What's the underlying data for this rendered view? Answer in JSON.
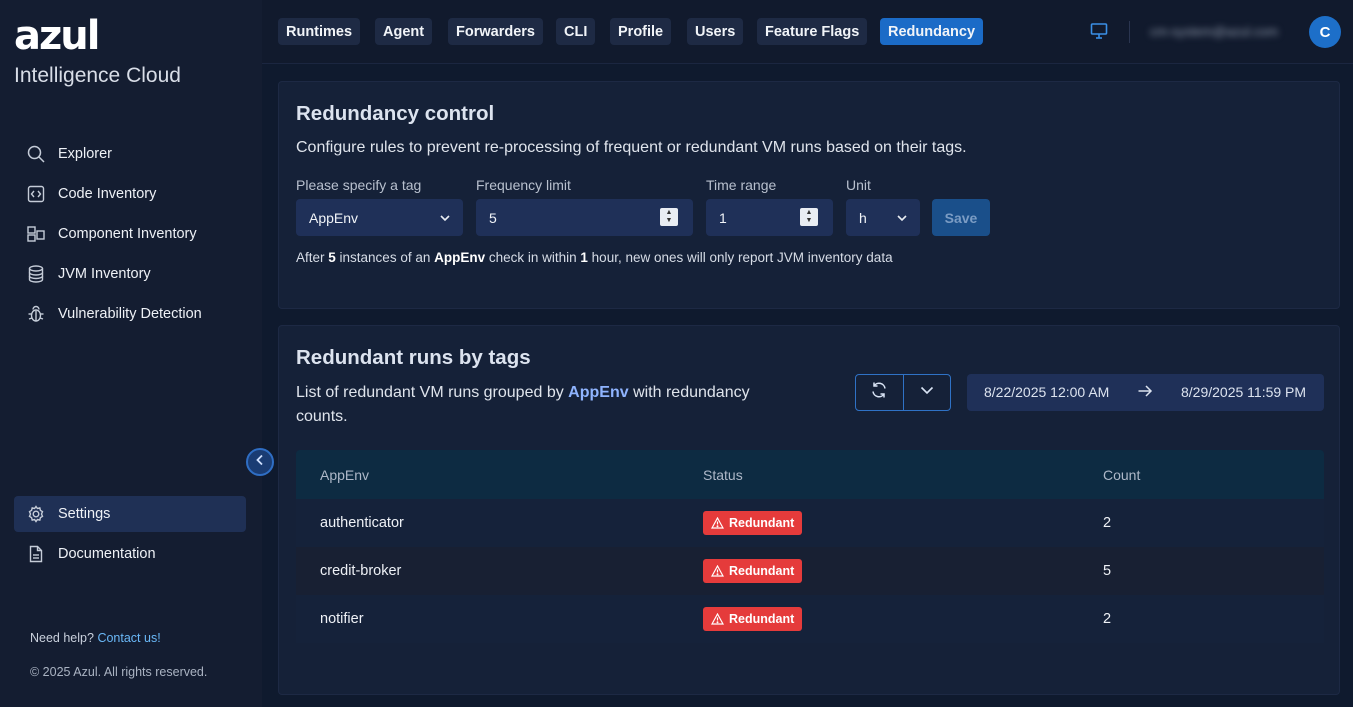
{
  "brand": {
    "logo": "azul",
    "subtitle": "Intelligence Cloud"
  },
  "sidebar": {
    "items": [
      {
        "label": "Explorer",
        "icon": "search-icon"
      },
      {
        "label": "Code Inventory",
        "icon": "code-icon"
      },
      {
        "label": "Component Inventory",
        "icon": "components-icon"
      },
      {
        "label": "JVM Inventory",
        "icon": "database-icon"
      },
      {
        "label": "Vulnerability Detection",
        "icon": "bug-icon"
      }
    ],
    "bottom_items": [
      {
        "label": "Settings",
        "icon": "gear-icon",
        "active": true
      },
      {
        "label": "Documentation",
        "icon": "document-icon"
      }
    ],
    "help_text": "Need help?",
    "help_link": "Contact us!",
    "copyright": "© 2025 Azul. All rights reserved."
  },
  "topbar": {
    "tabs": [
      "Runtimes",
      "Agent",
      "Forwarders",
      "CLI",
      "Profile",
      "Users",
      "Feature Flags",
      "Redundancy"
    ],
    "active_tab": "Redundancy",
    "user_email": "cm-system@azul.com",
    "avatar_initial": "C"
  },
  "redundancy_control": {
    "title": "Redundancy control",
    "description": "Configure rules to prevent re-processing of frequent or redundant VM runs based on their tags.",
    "tag_label": "Please specify a tag",
    "tag_value": "AppEnv",
    "frequency_label": "Frequency limit",
    "frequency_value": "5",
    "time_label": "Time range",
    "time_value": "1",
    "unit_label": "Unit",
    "unit_value": "h",
    "save_label": "Save",
    "summary": {
      "p1": "After ",
      "count": "5",
      "p2": " instances of an ",
      "tag": "AppEnv",
      "p3": " check in within ",
      "time": "1",
      "p4": " hour, new ones will only report JVM inventory data"
    }
  },
  "redundant_runs": {
    "title": "Redundant runs by tags",
    "desc_p1": "List of redundant VM runs grouped by ",
    "desc_tag": "AppEnv",
    "desc_p2": " with redundancy counts.",
    "date_from": "8/22/2025 12:00 AM",
    "date_to": "8/29/2025 11:59 PM",
    "columns": [
      "AppEnv",
      "Status",
      "Count"
    ],
    "rows": [
      {
        "appenv": "authenticator",
        "status": "Redundant",
        "count": "2"
      },
      {
        "appenv": "credit-broker",
        "status": "Redundant",
        "count": "5"
      },
      {
        "appenv": "notifier",
        "status": "Redundant",
        "count": "2"
      }
    ]
  },
  "colors": {
    "accent": "#1b6bc7",
    "danger": "#e53b3b",
    "background": "#0f1a2e",
    "sidebar": "#141d31"
  }
}
